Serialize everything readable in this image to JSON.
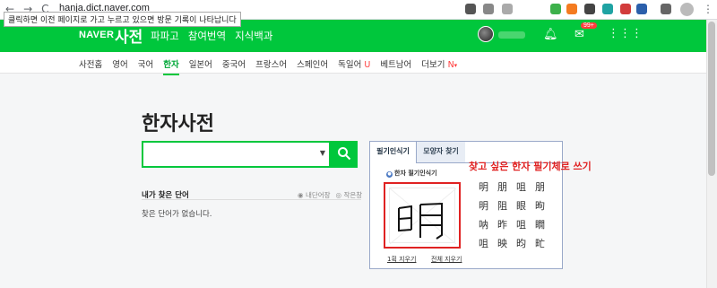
{
  "browser": {
    "url": "hanja.dict.naver.com",
    "tooltip": "클릭하면 이전 페이지로 가고 누르고 있으면 방문 기록이 나타납니다",
    "back": "←",
    "forward": "→",
    "reload": "C"
  },
  "header": {
    "logo": "NAVER",
    "title": "사전",
    "menu": [
      "파파고",
      "참여번역",
      "지식백과"
    ],
    "mail_badge": "99+"
  },
  "subnav": {
    "items": [
      "사전홈",
      "영어",
      "국어",
      "한자",
      "일본어",
      "중국어",
      "프랑스어",
      "스페인어",
      "독일어",
      "베트남어",
      "더보기"
    ],
    "active_index": 3,
    "german_badge": "U",
    "more_badge": "N"
  },
  "main": {
    "title": "한자사전",
    "search_placeholder": "",
    "my_words_title": "내가 찾은 단어",
    "radio_1": "내단어장",
    "radio_2": "작은창",
    "no_words": "찾은 단어가 없습니다."
  },
  "handwriting": {
    "tab_1": "필기인식기",
    "tab_2": "모양자 찾기",
    "heading": "한자 필기인식기",
    "erase_one": "1획 지우기",
    "erase_all": "전체 지우기",
    "candidates": [
      "明",
      "朋",
      "咀",
      "朋",
      "明",
      "阻",
      "眼",
      "昫",
      "呐",
      "昨",
      "咀",
      "瞯",
      "咀",
      "映",
      "昀",
      "甿"
    ]
  },
  "annotation": "찾고 싶은 한자 필기체로 쓰기",
  "colors": {
    "naver_green": "#00c73c",
    "annotation_red": "#e02222"
  }
}
